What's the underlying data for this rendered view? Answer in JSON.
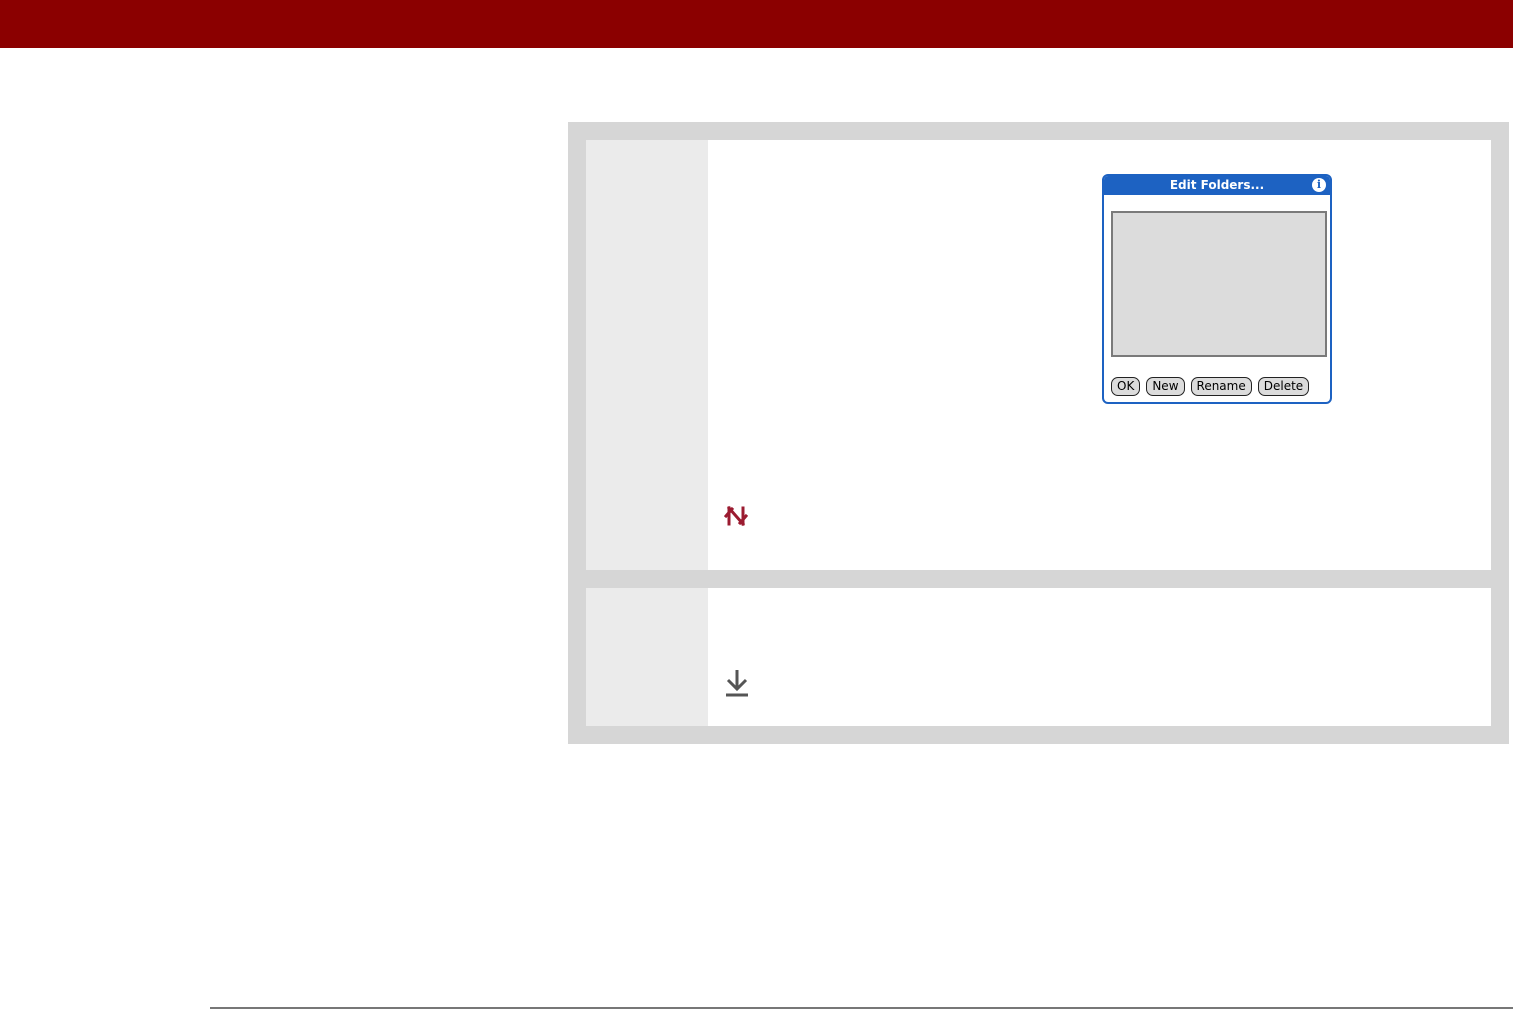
{
  "colors": {
    "header_bar": "#8b0000",
    "panel_bg": "#d6d6d6",
    "step_number_bg": "#ebebeb",
    "dialog_blue": "#1d62c2",
    "tip_icon": "#9b1b30",
    "download_icon": "#555555"
  },
  "dialog": {
    "title": "Edit Folders...",
    "info_glyph": "i",
    "buttons": {
      "ok": "OK",
      "new": "New",
      "rename": "Rename",
      "delete": "Delete"
    }
  },
  "icons": {
    "tip": "tip-icon",
    "download": "download-icon"
  }
}
